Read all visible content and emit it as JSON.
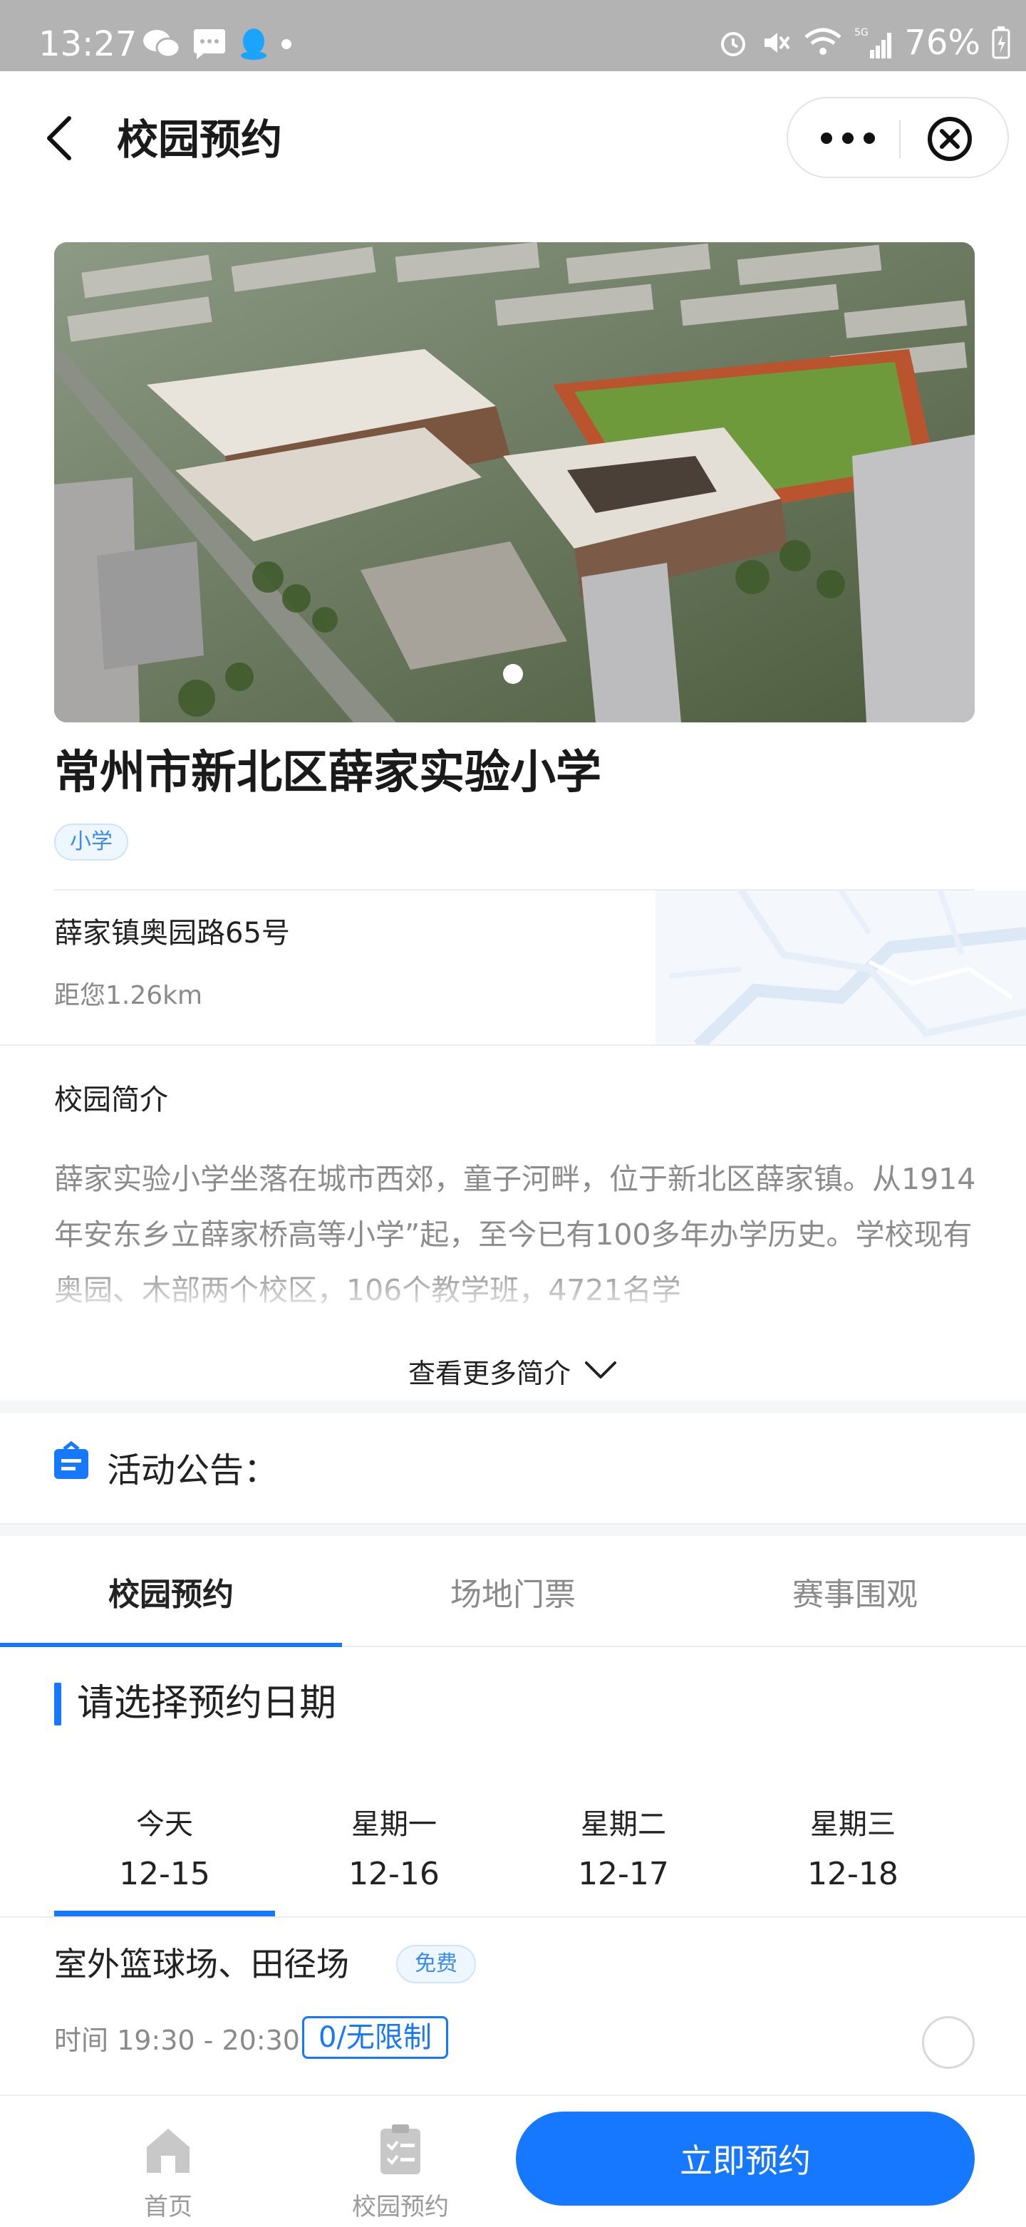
{
  "status_bar": {
    "time": "13:27",
    "battery": "76%",
    "left_icons": [
      "wechat-icon",
      "message-icon",
      "qq-icon",
      "dot-icon"
    ],
    "right_icons": [
      "alarm-icon",
      "mute-icon",
      "wifi-icon",
      "signal-5g-icon",
      "battery-icon"
    ]
  },
  "nav": {
    "title": "校园预约",
    "back_icon": "back-arrow-icon",
    "more_icon": "more-dots-icon",
    "close_icon": "close-circle-icon"
  },
  "banner": {
    "slide_count": 1,
    "active_index": 0
  },
  "school": {
    "name": "常州市新北区薛家实验小学",
    "tag": "小学",
    "address": "薛家镇奥园路65号",
    "distance": "距您1.26km"
  },
  "intro": {
    "title": "校园简介",
    "text": "薛家实验小学坐落在城市西郊，童子河畔，位于新北区薛家镇。从1914年安东乡立薛家桥高等小学”起，至今已有100多年办学历史。学校现有奥园、木部两个校区，106个教学班，4721名学",
    "more_label": "查看更多简介"
  },
  "notice": {
    "label": "活动公告："
  },
  "tabs": [
    {
      "label": "校园预约",
      "active": true
    },
    {
      "label": "场地门票",
      "active": false
    },
    {
      "label": "赛事围观",
      "active": false
    }
  ],
  "section": {
    "title": "请选择预约日期"
  },
  "dates": [
    {
      "week": "今天",
      "day": "12-15",
      "active": true
    },
    {
      "week": "星期一",
      "day": "12-16",
      "active": false
    },
    {
      "week": "星期二",
      "day": "12-17",
      "active": false
    },
    {
      "week": "星期三",
      "day": "12-18",
      "active": false
    }
  ],
  "venue": {
    "name": "室外篮球场、田径场",
    "tag": "免费",
    "time": "时间 19:30 - 20:30",
    "quota": "0/无限制"
  },
  "bottom_nav": {
    "home_label": "首页",
    "booking_label": "校园预约",
    "book_button": "立即预约"
  },
  "colors": {
    "accent": "#1677ff",
    "tag_bg": "#eef6ff",
    "muted_text": "#8a8a8a"
  }
}
